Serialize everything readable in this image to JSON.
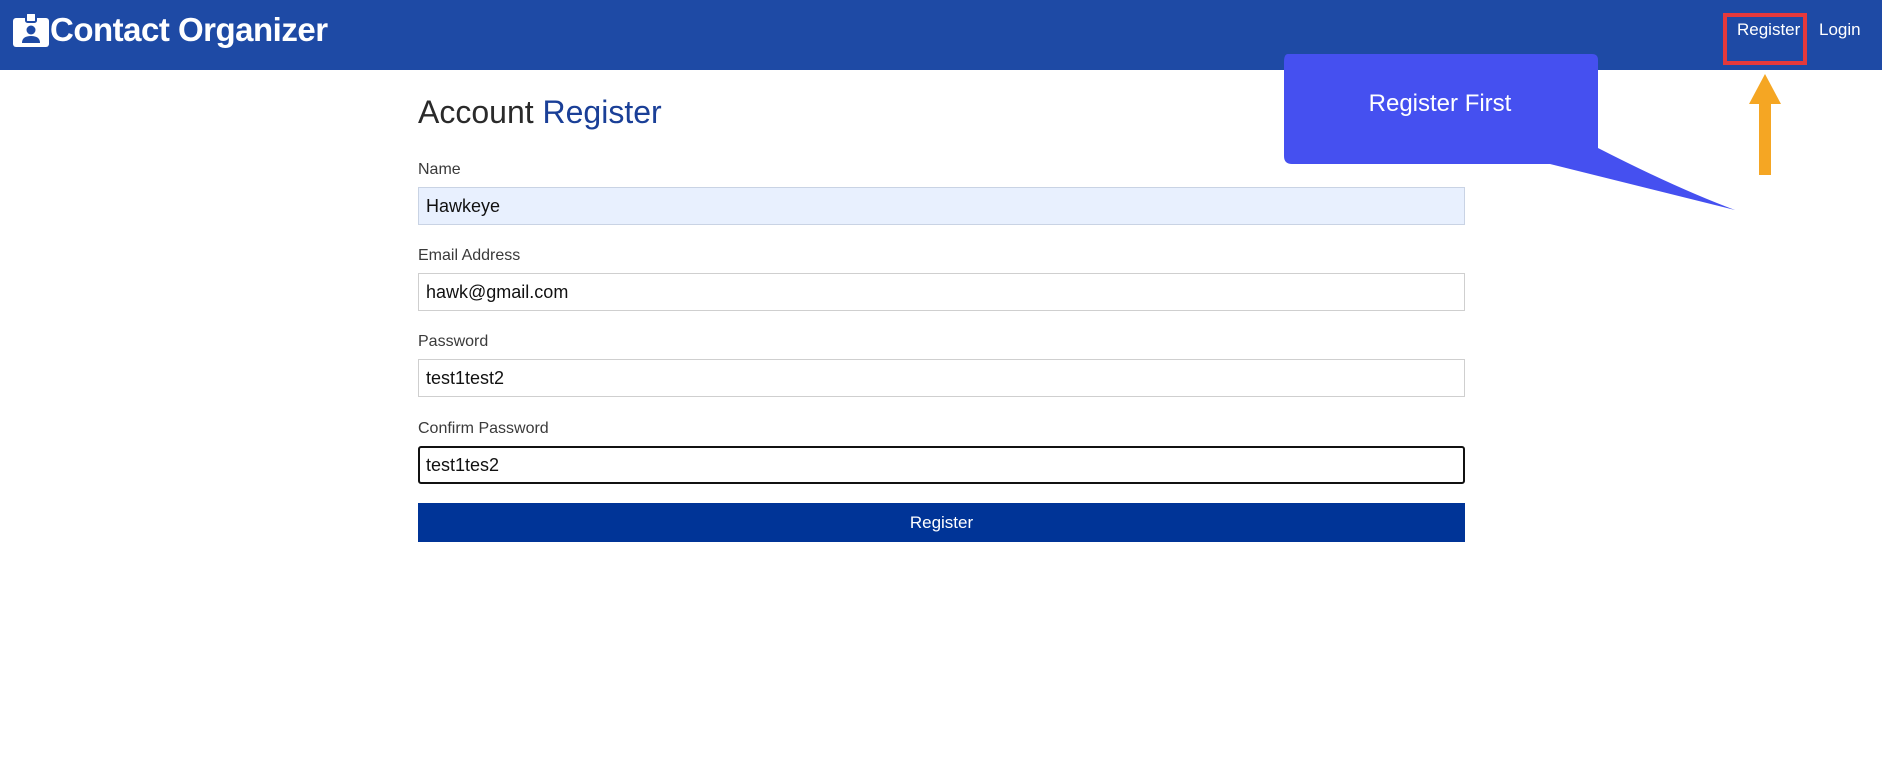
{
  "header": {
    "brand_icon": "contact-card-icon",
    "brand": "Contact Organizer",
    "nav": {
      "register": "Register",
      "login": "Login"
    },
    "colors": {
      "navbar": "#1e4aa5",
      "highlight": "#e5393c"
    }
  },
  "form": {
    "title_part1": "Account",
    "title_part2": "Register",
    "fields": [
      {
        "label": "Name",
        "value": "Hawkeye"
      },
      {
        "label": "Email Address",
        "value": "hawk@gmail.com"
      },
      {
        "label": "Password",
        "value": "test1test2"
      },
      {
        "label": "Confirm Password",
        "value": "test1tes2"
      }
    ],
    "submit_label": "Register",
    "colors": {
      "accent": "#1a3f97",
      "button": "#003497"
    }
  },
  "annotation": {
    "callout_text": "Register First",
    "callout_color": "#4550f0",
    "arrow_icon": "up-arrow-icon",
    "arrow_color": "#f5a623"
  }
}
